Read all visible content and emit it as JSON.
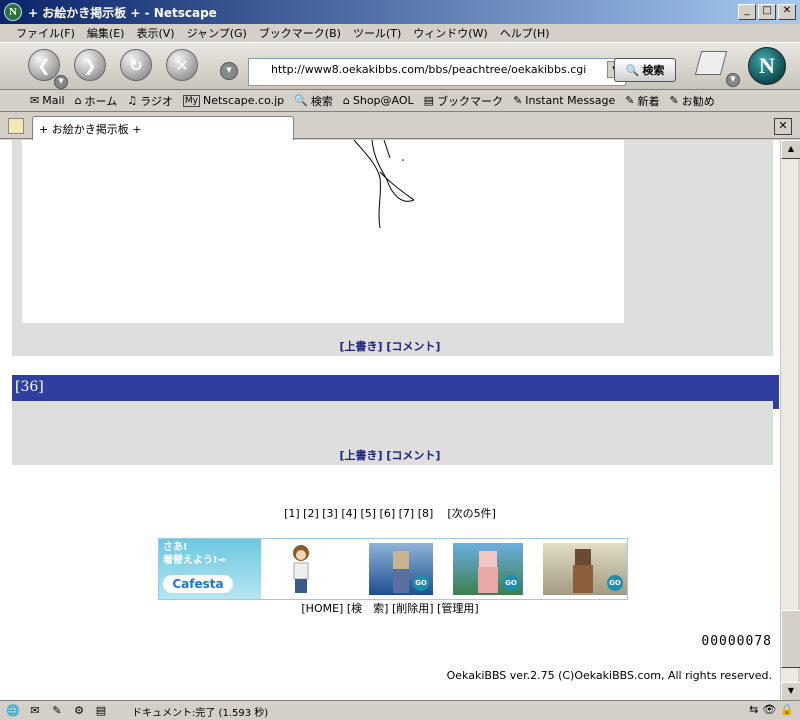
{
  "window": {
    "title": "+ お絵かき掲示板 + - Netscape",
    "app_icon": "N",
    "btn_min": "_",
    "btn_max": "□",
    "btn_close": "✕"
  },
  "menu": [
    "ファイル(F)",
    "編集(E)",
    "表示(V)",
    "ジャンプ(G)",
    "ブックマーク(B)",
    "ツール(T)",
    "ウィンドウ(W)",
    "ヘルプ(H)"
  ],
  "nav": {
    "url": "http://www8.oekakibbs.com/bbs/peachtree/oekakibbs.cgi",
    "search_label": "検索",
    "icons": [
      "back-icon",
      "forward-icon",
      "reload-icon",
      "stop-icon"
    ],
    "glyphs": {
      "back": "❮",
      "forward": "❯",
      "reload": "↻",
      "stop": "✕",
      "drop": "▼",
      "logo": "N",
      "search": "🔍"
    }
  },
  "personal_toolbar": [
    {
      "icon": "✉",
      "label": "Mail"
    },
    {
      "icon": "⌂",
      "label": "ホーム"
    },
    {
      "icon": "♫",
      "label": "ラジオ"
    },
    {
      "icon": "My",
      "label": "Netscape.co.jp"
    },
    {
      "icon": "🔍",
      "label": "検索"
    },
    {
      "icon": "⌂",
      "label": "Shop@AOL"
    },
    {
      "icon": "▤",
      "label": "ブックマーク"
    },
    {
      "icon": "✎",
      "label": "Instant Message"
    },
    {
      "icon": "✎",
      "label": "新着"
    },
    {
      "icon": "✎",
      "label": "お勧め"
    }
  ],
  "tab": {
    "label": "+ お絵かき掲示板 +",
    "close": "✕"
  },
  "content": {
    "post1_links": "[上書き] [コメント]",
    "post2_number": "[36]",
    "post2_links": "[上書き] [コメント]",
    "pager": [
      "[1]",
      "[2]",
      "[3]",
      "[4]",
      "[5]",
      "[6]",
      "[7]",
      "[8]"
    ],
    "pager_next": "[次の5件]",
    "banner": {
      "tagline_1": "さあ!",
      "tagline_2": "着替えよう!→",
      "logo": "Cafesta",
      "go": "GO"
    },
    "footer_links": [
      "[HOME]",
      "[検　索]",
      "[削除用]",
      "[管理用]"
    ],
    "counter": "00000078",
    "copyright": "OekakiBBS ver.2.75 (C)OekakiBBS.com, All rights reserved."
  },
  "status": {
    "text": "ドキュメント:完了 (1.593 秒)",
    "left_icons": [
      "🌐",
      "✉",
      "✎",
      "⚙",
      "▤"
    ],
    "right_icons": [
      "⇆",
      "👁",
      "🔒"
    ]
  },
  "scroll": {
    "up": "▲",
    "down": "▼"
  }
}
